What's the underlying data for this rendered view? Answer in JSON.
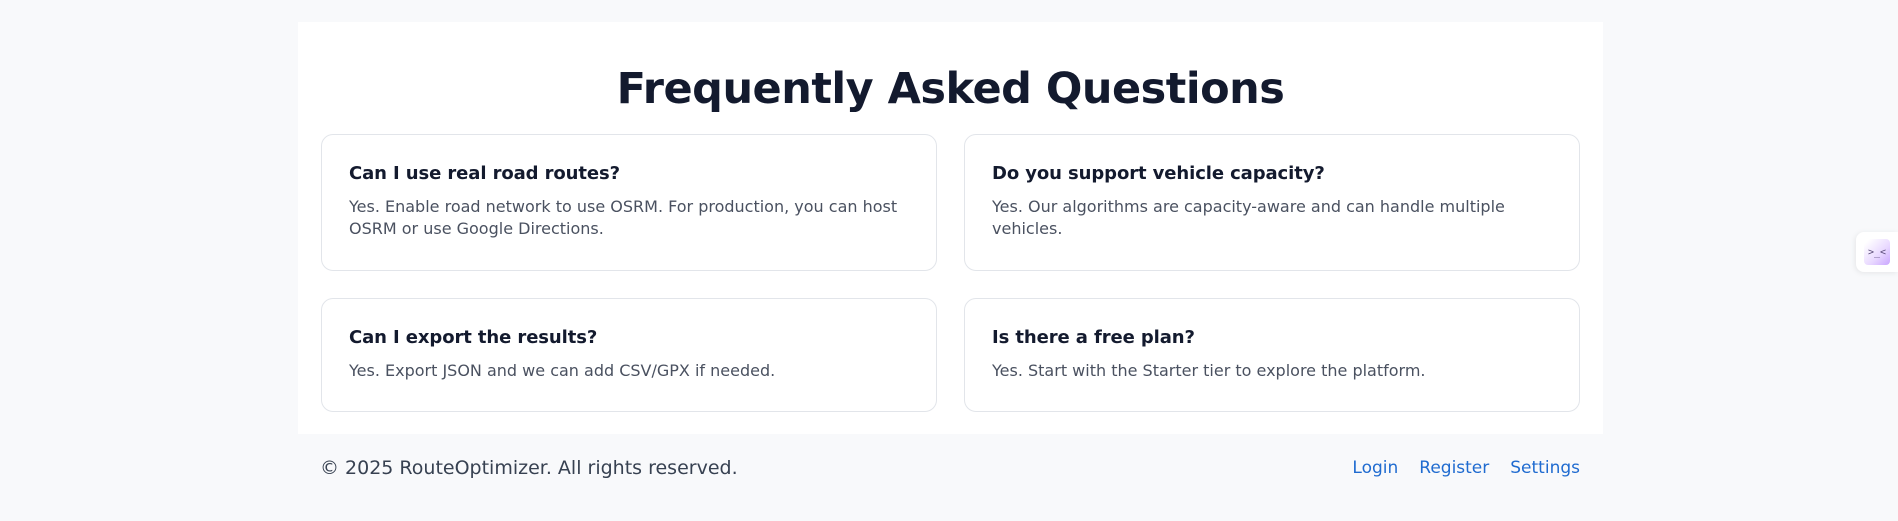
{
  "faq": {
    "title": "Frequently Asked Questions",
    "items": [
      {
        "question": "Can I use real road routes?",
        "answer": "Yes. Enable road network to use OSRM. For production, you can host OSRM or use Google Directions."
      },
      {
        "question": "Do you support vehicle capacity?",
        "answer": "Yes. Our algorithms are capacity-aware and can handle multiple vehicles."
      },
      {
        "question": "Can I export the results?",
        "answer": "Yes. Export JSON and we can add CSV/GPX if needed."
      },
      {
        "question": "Is there a free plan?",
        "answer": "Yes. Start with the Starter tier to explore the platform."
      }
    ]
  },
  "footer": {
    "copyright": "© 2025 RouteOptimizer. All rights reserved.",
    "links": [
      "Login",
      "Register",
      "Settings"
    ]
  },
  "side_widget": {
    "icon": "terminal-icon",
    "glyph": ">_<"
  }
}
